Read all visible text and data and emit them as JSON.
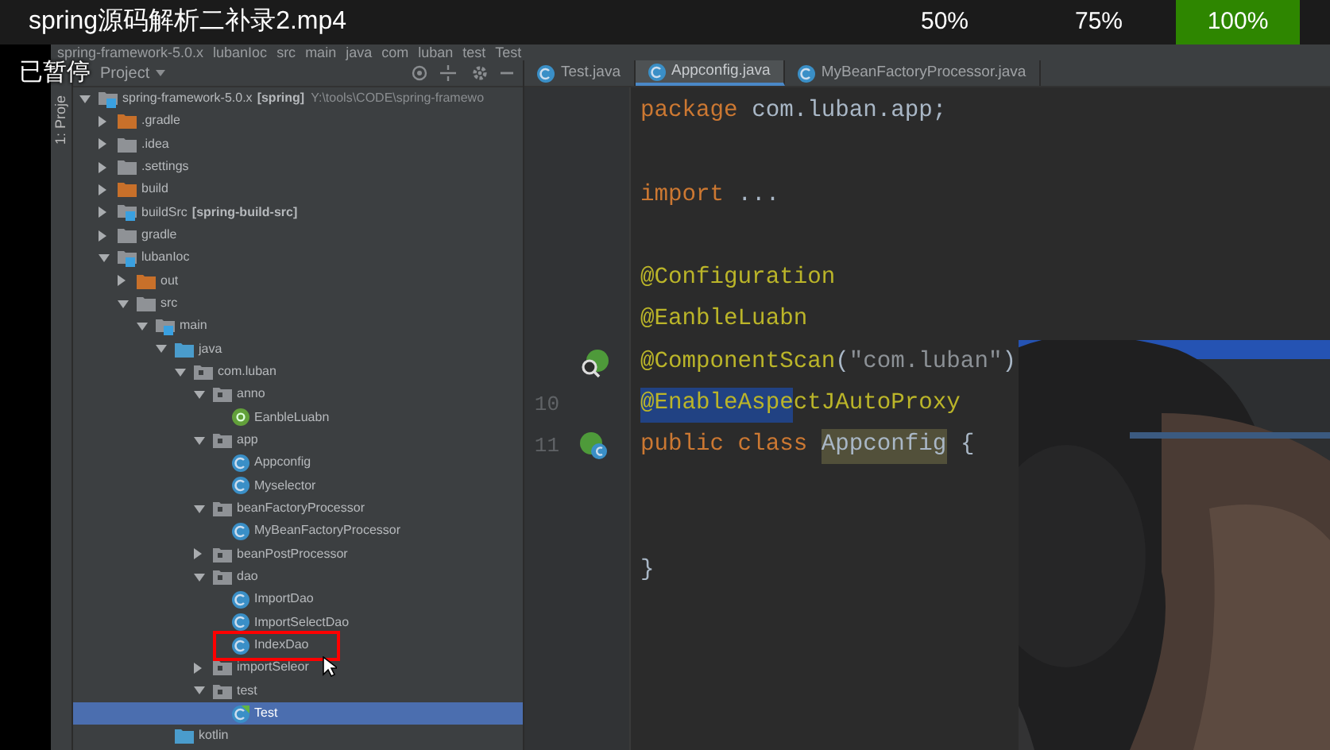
{
  "player": {
    "title": "spring源码解析二补录2.mp4",
    "status": "已暂停",
    "speed_options": [
      {
        "label": "50%",
        "selected": false
      },
      {
        "label": "75%",
        "selected": false
      },
      {
        "label": "100%",
        "selected": true
      }
    ]
  },
  "ide": {
    "breadcrumbs": [
      "spring-framework-5.0.x",
      "lubanIoc",
      "src",
      "main",
      "java",
      "com",
      "luban",
      "test",
      "Test"
    ],
    "project_panel": {
      "side_tab": "1: Proje",
      "title": "Project",
      "tree": [
        {
          "label": "spring-framework-5.0.x",
          "tag": "[spring]",
          "path": "Y:\\tools\\CODE\\spring-framewo",
          "kind": "module",
          "expanded": true,
          "children": [
            {
              "label": ".gradle",
              "kind": "excluded-folder",
              "expanded": false
            },
            {
              "label": ".idea",
              "kind": "folder",
              "expanded": false
            },
            {
              "label": ".settings",
              "kind": "folder",
              "expanded": false
            },
            {
              "label": "build",
              "kind": "excluded-folder",
              "expanded": false
            },
            {
              "label": "buildSrc",
              "tag": "[spring-build-src]",
              "kind": "module",
              "expanded": false
            },
            {
              "label": "gradle",
              "kind": "folder",
              "expanded": false
            },
            {
              "label": "lubanIoc",
              "kind": "module",
              "expanded": true,
              "children": [
                {
                  "label": "out",
                  "kind": "excluded-folder",
                  "expanded": false
                },
                {
                  "label": "src",
                  "kind": "folder",
                  "expanded": true,
                  "children": [
                    {
                      "label": "main",
                      "kind": "module",
                      "expanded": true,
                      "children": [
                        {
                          "label": "java",
                          "kind": "source-folder",
                          "expanded": true,
                          "children": [
                            {
                              "label": "com.luban",
                              "kind": "package",
                              "expanded": true,
                              "children": [
                                {
                                  "label": "anno",
                                  "kind": "package",
                                  "expanded": true,
                                  "children": [
                                    {
                                      "label": "EanbleLuabn",
                                      "kind": "annotation"
                                    }
                                  ]
                                },
                                {
                                  "label": "app",
                                  "kind": "package",
                                  "expanded": true,
                                  "children": [
                                    {
                                      "label": "Appconfig",
                                      "kind": "class"
                                    },
                                    {
                                      "label": "Myselector",
                                      "kind": "class"
                                    }
                                  ]
                                },
                                {
                                  "label": "beanFactoryProcessor",
                                  "kind": "package",
                                  "expanded": true,
                                  "children": [
                                    {
                                      "label": "MyBeanFactoryProcessor",
                                      "kind": "class"
                                    }
                                  ]
                                },
                                {
                                  "label": "beanPostProcessor",
                                  "kind": "package",
                                  "expanded": false
                                },
                                {
                                  "label": "dao",
                                  "kind": "package",
                                  "expanded": true,
                                  "children": [
                                    {
                                      "label": "ImportDao",
                                      "kind": "class"
                                    },
                                    {
                                      "label": "ImportSelectDao",
                                      "kind": "class"
                                    },
                                    {
                                      "label": "IndexDao",
                                      "kind": "class",
                                      "marked": true
                                    }
                                  ]
                                },
                                {
                                  "label": "importSeleor",
                                  "kind": "package",
                                  "expanded": false
                                },
                                {
                                  "label": "test",
                                  "kind": "package",
                                  "expanded": true,
                                  "children": [
                                    {
                                      "label": "Test",
                                      "kind": "test-class",
                                      "selected": true
                                    }
                                  ]
                                }
                              ]
                            }
                          ]
                        },
                        {
                          "label": "kotlin",
                          "kind": "source-folder"
                        }
                      ]
                    }
                  ]
                }
              ]
            }
          ]
        }
      ]
    },
    "editor": {
      "tabs": [
        {
          "label": "Test.java",
          "selected": false
        },
        {
          "label": "Appconfig.java",
          "selected": true
        },
        {
          "label": "MyBeanFactoryProcessor.java",
          "selected": false
        }
      ],
      "lines": [
        {
          "kind": "code",
          "tokens": [
            {
              "text": "package",
              "kind": "keyword"
            },
            {
              "text": " com.luban.app;",
              "kind": "plain"
            }
          ]
        },
        {
          "kind": "blank"
        },
        {
          "kind": "code",
          "tokens": [
            {
              "text": "import",
              "kind": "keyword"
            },
            {
              "text": " ...",
              "kind": "plain"
            }
          ]
        },
        {
          "kind": "blank"
        },
        {
          "kind": "code",
          "tokens": [
            {
              "text": "@Configuration",
              "kind": "annotation"
            }
          ]
        },
        {
          "kind": "code",
          "tokens": [
            {
              "text": "@EanbleLuabn",
              "kind": "annotation"
            }
          ]
        },
        {
          "kind": "code",
          "gutter": {
            "kind": "bean-search"
          },
          "tokens": [
            {
              "text": "@ComponentScan",
              "kind": "annotation"
            },
            {
              "text": "(",
              "kind": "plain"
            },
            {
              "text": "\"com.luban\"",
              "kind": "string"
            },
            {
              "text": ")",
              "kind": "plain"
            }
          ]
        },
        {
          "kind": "code",
          "number": "10",
          "tokens": [
            {
              "text": "@EnableAspe",
              "kind": "annotation",
              "selected": true
            },
            {
              "text": "ctJAutoProxy",
              "kind": "annotation",
              "selected": false
            }
          ]
        },
        {
          "kind": "code",
          "number": "11",
          "gutter": {
            "kind": "bean-class"
          },
          "tokens": [
            {
              "text": "public class ",
              "kind": "keyword"
            },
            {
              "text": "Appconfig",
              "kind": "usage"
            },
            {
              "text": " {",
              "kind": "plain"
            }
          ]
        },
        {
          "kind": "blank"
        },
        {
          "kind": "blank"
        },
        {
          "kind": "code",
          "tokens": [
            {
              "text": "}",
              "kind": "plain"
            }
          ]
        }
      ]
    }
  }
}
